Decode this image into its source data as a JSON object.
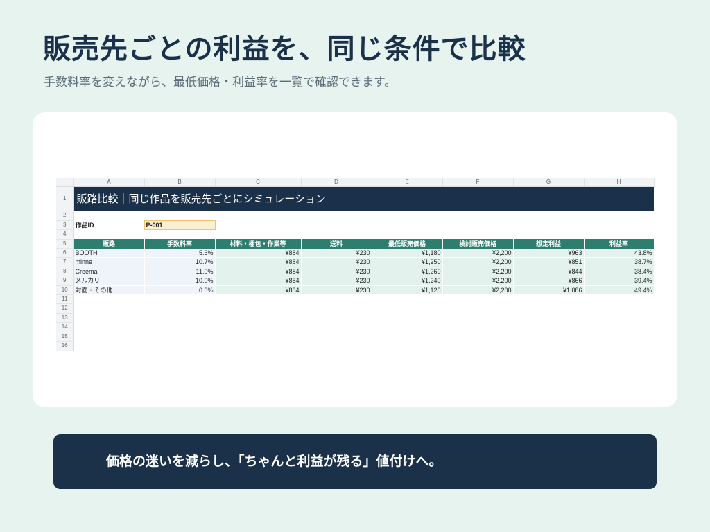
{
  "slide": {
    "headline": "販売先ごとの利益を、同じ条件で比較",
    "subline": "手数料率を変えながら、最低価格・利益率を一覧で確認できます。",
    "banner": "価格の迷いを減らし、「ちゃんと利益が残る」値付けへ。"
  },
  "sheet": {
    "columns": [
      "A",
      "B",
      "C",
      "D",
      "E",
      "F",
      "G",
      "H"
    ],
    "row_numbers": [
      "1",
      "2",
      "3",
      "4",
      "5",
      "6",
      "7",
      "8",
      "9",
      "10",
      "11",
      "12",
      "13",
      "14",
      "15",
      "16"
    ],
    "title": "販路比較｜同じ作品を販売先ごとにシミュレーション",
    "work_id_label": "作品ID",
    "work_id_value": "P-001",
    "headers": [
      "販路",
      "手数料率",
      "材料・梱包・作業等",
      "送料",
      "最低販売価格",
      "検討販売価格",
      "想定利益",
      "利益率"
    ],
    "rows": [
      [
        "BOOTH",
        "5.6%",
        "¥884",
        "¥230",
        "¥1,180",
        "¥2,200",
        "¥963",
        "43.8%"
      ],
      [
        "minne",
        "10.7%",
        "¥884",
        "¥230",
        "¥1,250",
        "¥2,200",
        "¥851",
        "38.7%"
      ],
      [
        "Creema",
        "11.0%",
        "¥884",
        "¥230",
        "¥1,260",
        "¥2,200",
        "¥844",
        "38.4%"
      ],
      [
        "メルカリ",
        "10.0%",
        "¥884",
        "¥230",
        "¥1,240",
        "¥2,200",
        "¥866",
        "39.4%"
      ],
      [
        "対面・その他",
        "0.0%",
        "¥884",
        "¥230",
        "¥1,120",
        "¥2,200",
        "¥1,086",
        "49.4%"
      ]
    ]
  },
  "colors": {
    "background": "#e6f3ef",
    "navy": "#1b3149",
    "teal_header": "#2e7d6e",
    "id_fill": "#fbefd1"
  }
}
